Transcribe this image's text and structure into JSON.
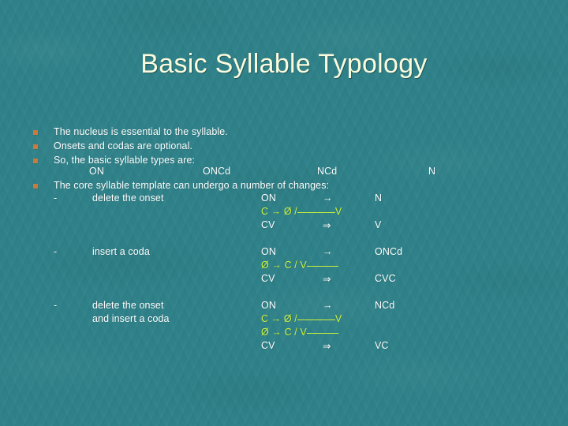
{
  "slide": {
    "title": "Basic Syllable Typology",
    "background_color": "#2f8189",
    "title_color": "#fbfbdd",
    "body_text_color": "#ffffff",
    "rule_text_color": "#ccf23c",
    "bullet_color": "#c97a3c"
  },
  "bullets": [
    {
      "text": "The nucleus is essential to the syllable."
    },
    {
      "text": "Onsets and codas are optional."
    },
    {
      "text": "So, the basic syllable types are:"
    },
    {
      "text": "The core syllable template can undergo a number of changes:"
    }
  ],
  "syllable_types": {
    "type1": "ON",
    "type2": "ONCd",
    "type3": "NCd",
    "type4": "N"
  },
  "changes": [
    {
      "dash": "-",
      "label_line1": "delete the onset",
      "label_line2": "",
      "template_input": "ON",
      "template_arrow": "→",
      "template_output": "N",
      "rules": [
        {
          "left": "C → Ø /",
          "blank_first": true,
          "right": "V"
        }
      ],
      "example_input": "CV",
      "example_arrow": "⇒",
      "example_output": "V"
    },
    {
      "dash": "-",
      "label_line1": "insert a coda",
      "label_line2": "",
      "template_input": "ON",
      "template_arrow": "→",
      "template_output": "ONCd",
      "rules": [
        {
          "left": "Ø → C / V",
          "blank_first": false,
          "right": ""
        }
      ],
      "example_input": "CV",
      "example_arrow": "⇒",
      "example_output": "CVC"
    },
    {
      "dash": "-",
      "label_line1": "delete the onset",
      "label_line2": "and insert a coda",
      "template_input": "ON",
      "template_arrow": "→",
      "template_output": "NCd",
      "rules": [
        {
          "left": "C → Ø /",
          "blank_first": true,
          "right": "V"
        },
        {
          "left": "Ø → C / V",
          "blank_first": false,
          "right": ""
        }
      ],
      "example_input": "CV",
      "example_arrow": "⇒",
      "example_output": "VC"
    }
  ]
}
